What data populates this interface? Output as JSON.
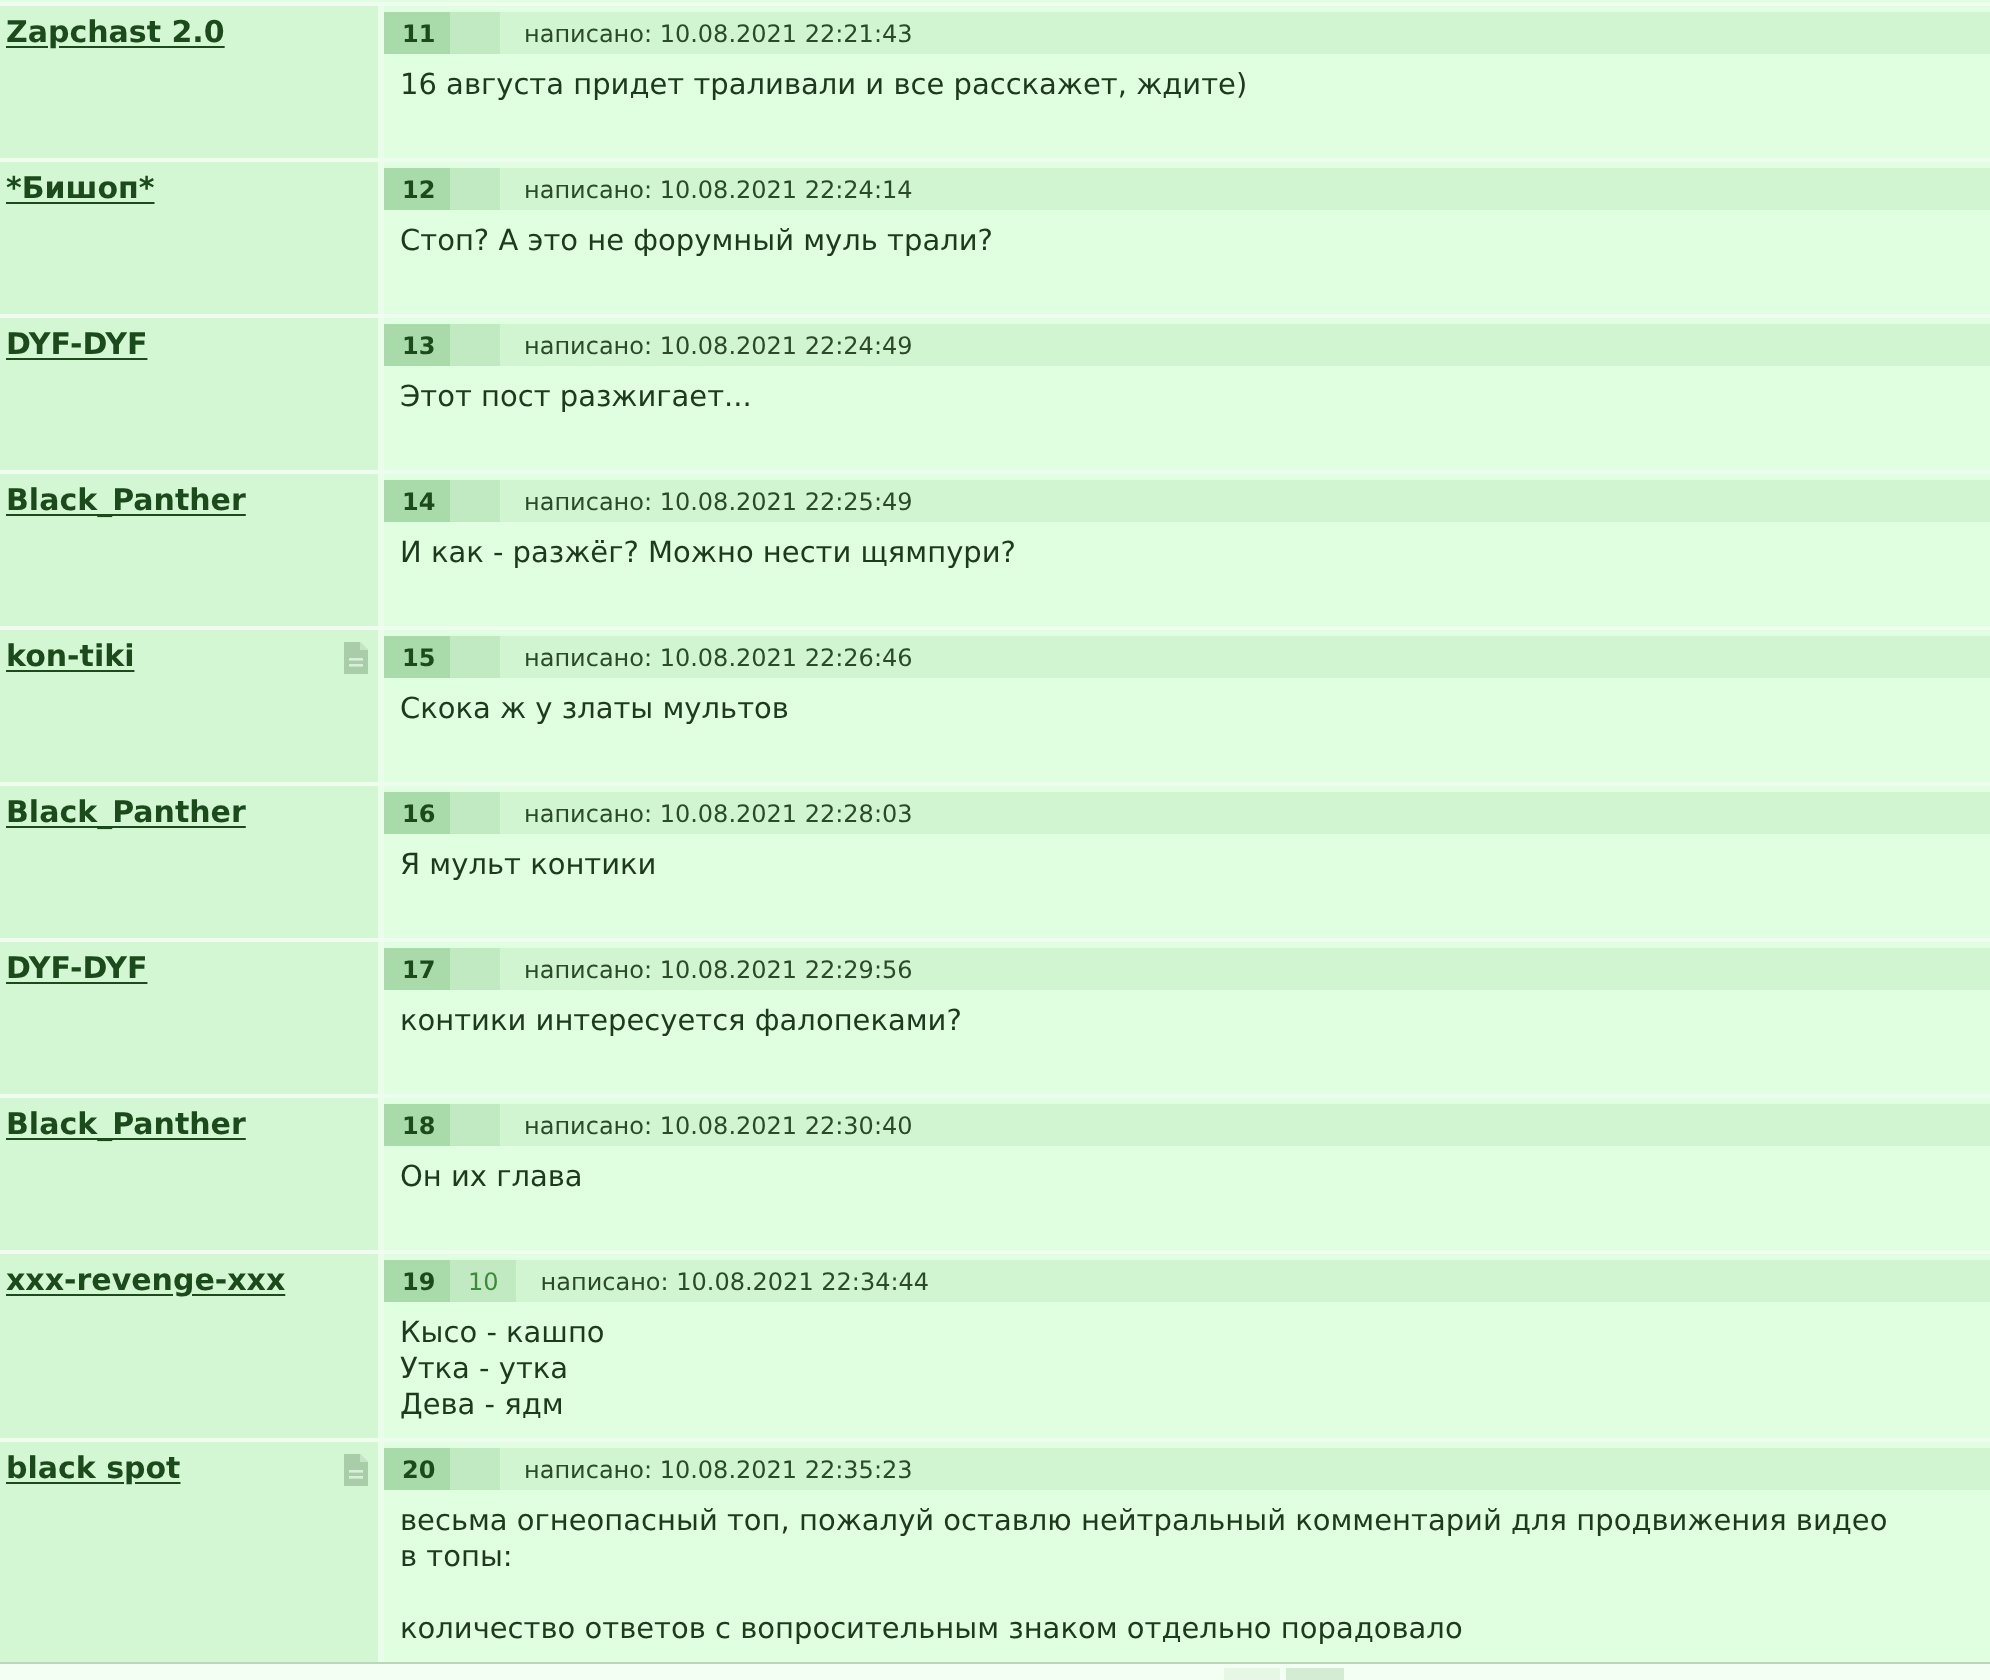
{
  "posts": [
    {
      "author": "Zapchast 2.0",
      "note_icon": false,
      "number": "11",
      "posted": "написано: 10.08.2021 22:21:43",
      "paragraphs": [
        [
          "16 августа придет траливали и все расскажет, ждите)"
        ]
      ]
    },
    {
      "author": "*Бишоп*",
      "note_icon": false,
      "number": "12",
      "posted": "написано: 10.08.2021 22:24:14",
      "paragraphs": [
        [
          "Стоп? А это не форумный муль трали?"
        ]
      ]
    },
    {
      "author": "DYF-DYF",
      "note_icon": false,
      "number": "13",
      "posted": "написано: 10.08.2021 22:24:49",
      "paragraphs": [
        [
          "Этот пост разжигает..."
        ]
      ]
    },
    {
      "author": "Black_Panther",
      "note_icon": false,
      "number": "14",
      "posted": "написано: 10.08.2021 22:25:49",
      "paragraphs": [
        [
          "И как - разжёг? Можно нести щямпури?"
        ]
      ]
    },
    {
      "author": "kon-tiki",
      "note_icon": true,
      "number": "15",
      "posted": "написано: 10.08.2021 22:26:46",
      "paragraphs": [
        [
          "Скока ж у златы мультов"
        ]
      ]
    },
    {
      "author": "Black_Panther",
      "note_icon": false,
      "number": "16",
      "posted": "написано: 10.08.2021 22:28:03",
      "paragraphs": [
        [
          "Я мульт контики"
        ]
      ]
    },
    {
      "author": "DYF-DYF",
      "note_icon": false,
      "number": "17",
      "posted": "написано: 10.08.2021 22:29:56",
      "paragraphs": [
        [
          "контики интересуется фалопеками?"
        ]
      ]
    },
    {
      "author": "Black_Panther",
      "note_icon": false,
      "number": "18",
      "posted": "написано: 10.08.2021 22:30:40",
      "paragraphs": [
        [
          "Он их глава"
        ]
      ]
    },
    {
      "author": "xxx-revenge-xxx",
      "note_icon": false,
      "number": "19",
      "score": "10",
      "posted": "написано: 10.08.2021 22:34:44",
      "paragraphs": [
        [
          "Кысо - кашпо",
          "Утка - утка",
          "Дева - ядм"
        ]
      ]
    },
    {
      "author": "black spot",
      "note_icon": true,
      "number": "20",
      "posted": "написано: 10.08.2021 22:35:23",
      "paragraphs": [
        [
          "весьма огнеопасный топ, пожалуй оставлю нейтральный комментарий для продвижения видео",
          "в топы:"
        ],
        [
          "количество ответов с вопросительным знаком отдельно порадовало"
        ]
      ]
    }
  ]
}
